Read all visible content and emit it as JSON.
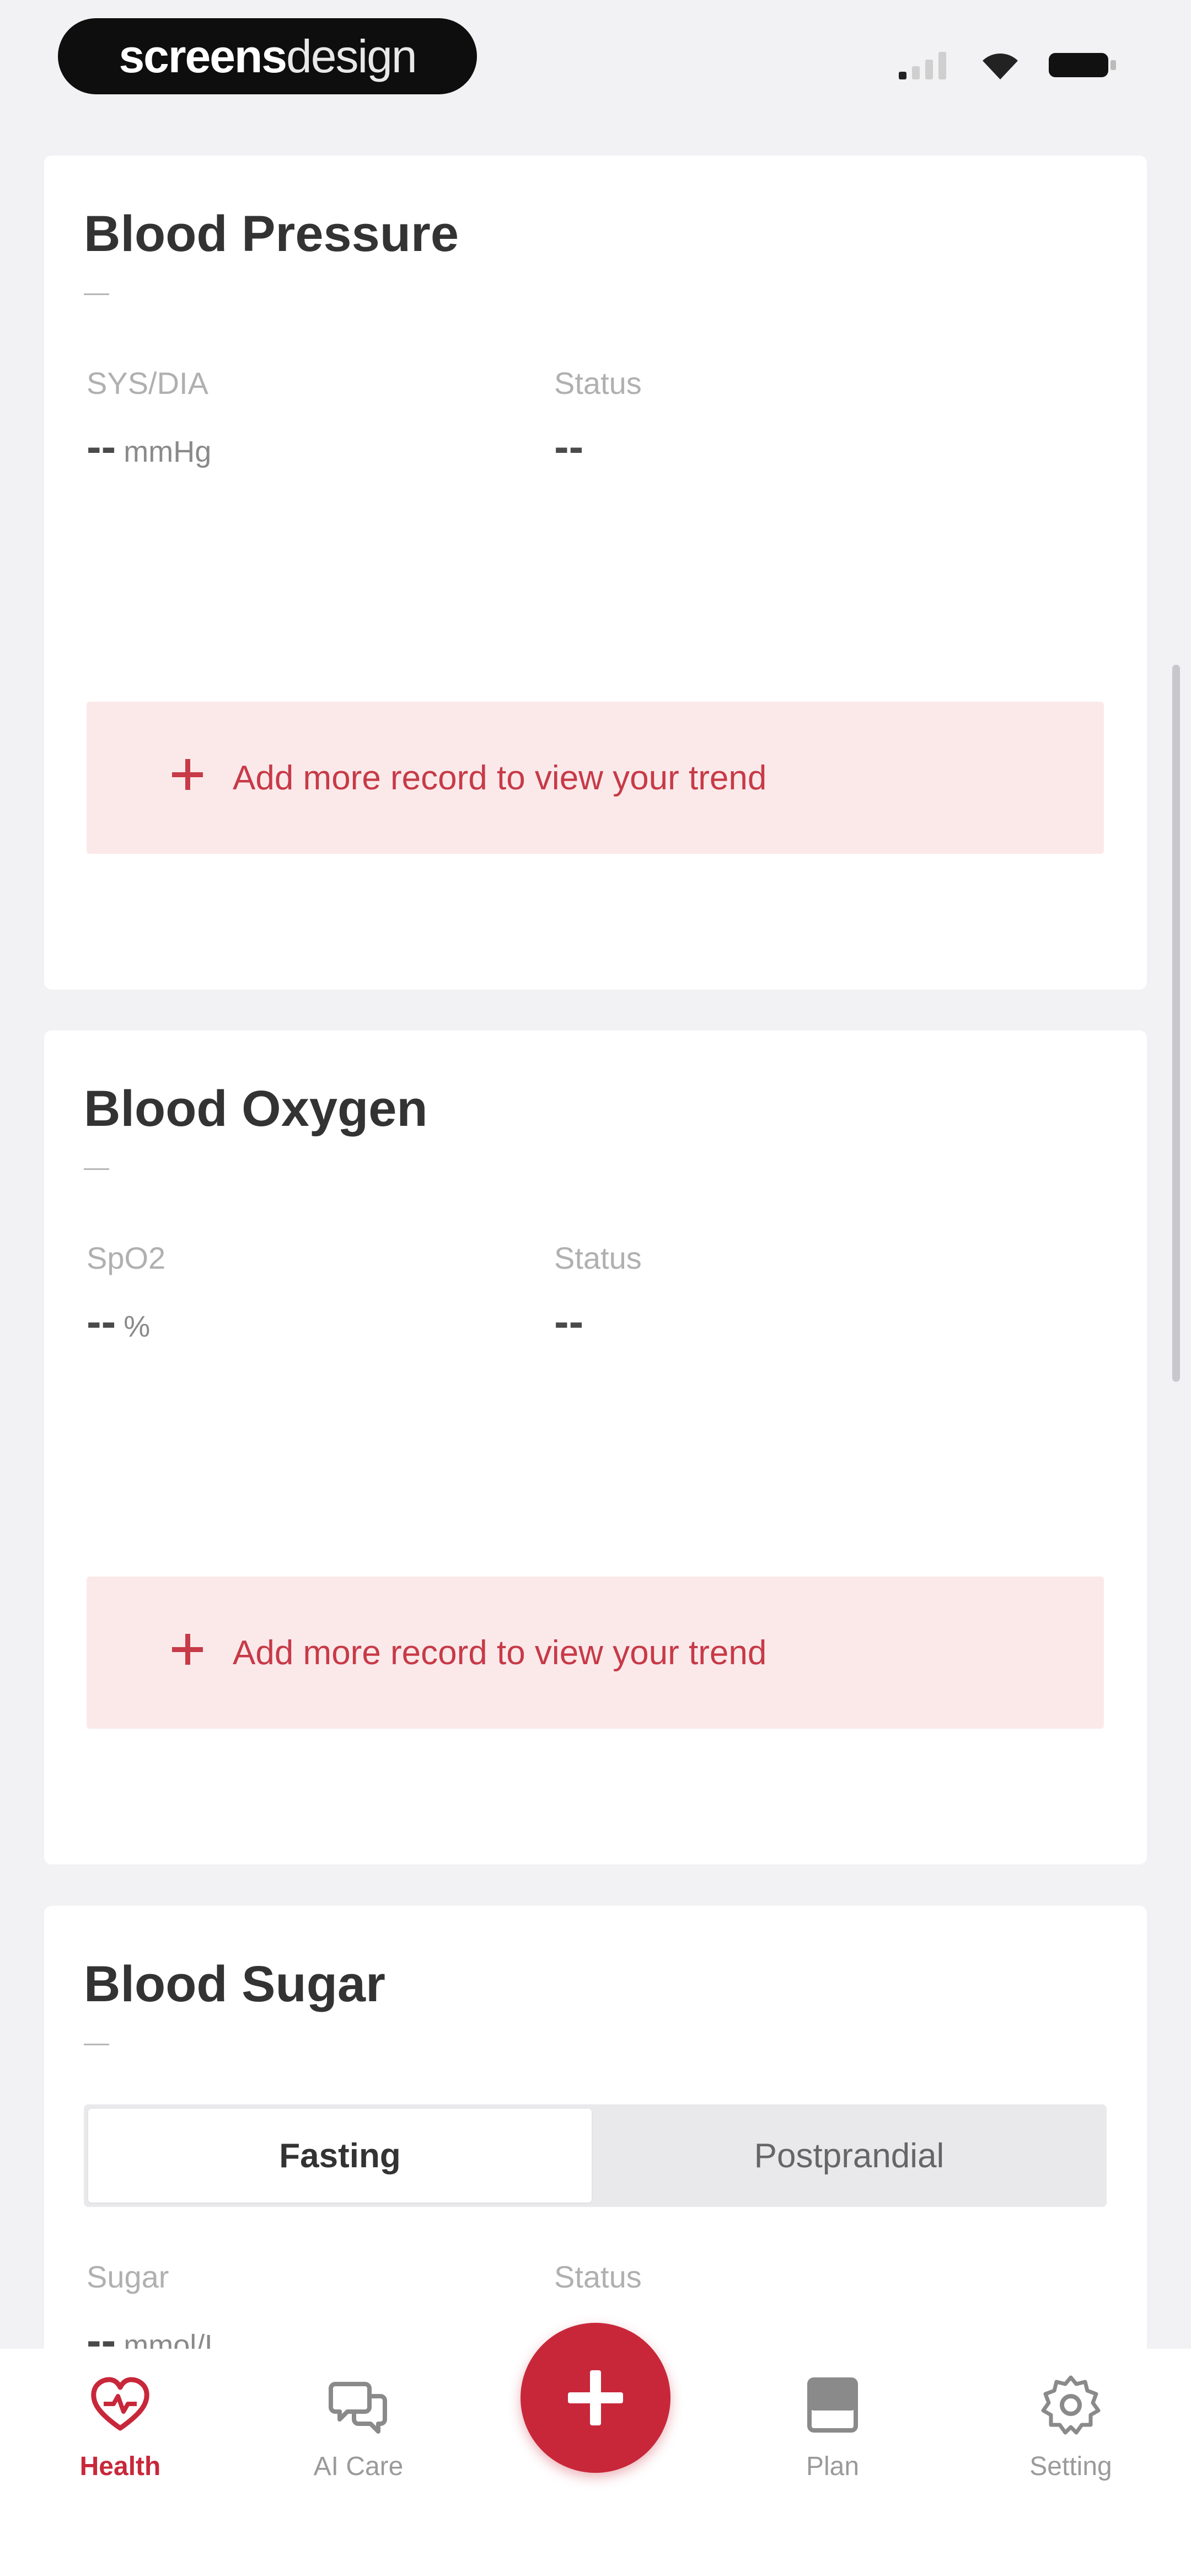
{
  "status_bar": {
    "brand_bold": "screens",
    "brand_light": "design",
    "icons": [
      "signal-icon",
      "wifi-icon",
      "battery-icon"
    ]
  },
  "cards": {
    "blood_pressure": {
      "title": "Blood Pressure",
      "subtitle": "—",
      "metric_label": "SYS/DIA",
      "metric_value": "--",
      "metric_unit": "mmHg",
      "status_label": "Status",
      "status_value": "--",
      "trend_button": "Add more record to view your trend"
    },
    "blood_oxygen": {
      "title": "Blood Oxygen",
      "subtitle": "—",
      "metric_label": "SpO2",
      "metric_value": "--",
      "metric_unit": "%",
      "status_label": "Status",
      "status_value": "--",
      "trend_button": "Add more record to view your trend"
    },
    "blood_sugar": {
      "title": "Blood Sugar",
      "subtitle": "—",
      "segments": [
        "Fasting",
        "Postprandial"
      ],
      "selected_segment": "Fasting",
      "metric_label": "Sugar",
      "metric_value": "--",
      "metric_unit": "mmol/L",
      "status_label": "Status"
    }
  },
  "tabbar": {
    "items": [
      {
        "label": "Health",
        "icon": "heart-pulse-icon",
        "active": true
      },
      {
        "label": "AI Care",
        "icon": "chat-bubble-icon",
        "active": false
      },
      {
        "label": "Plan",
        "icon": "plan-icon",
        "active": false
      },
      {
        "label": "Setting",
        "icon": "gear-icon",
        "active": false
      }
    ],
    "fab_icon": "plus-icon"
  },
  "colors": {
    "accent": "#c8273a",
    "trend_bg": "#fbe9ea",
    "page_bg": "#f2f2f4"
  }
}
